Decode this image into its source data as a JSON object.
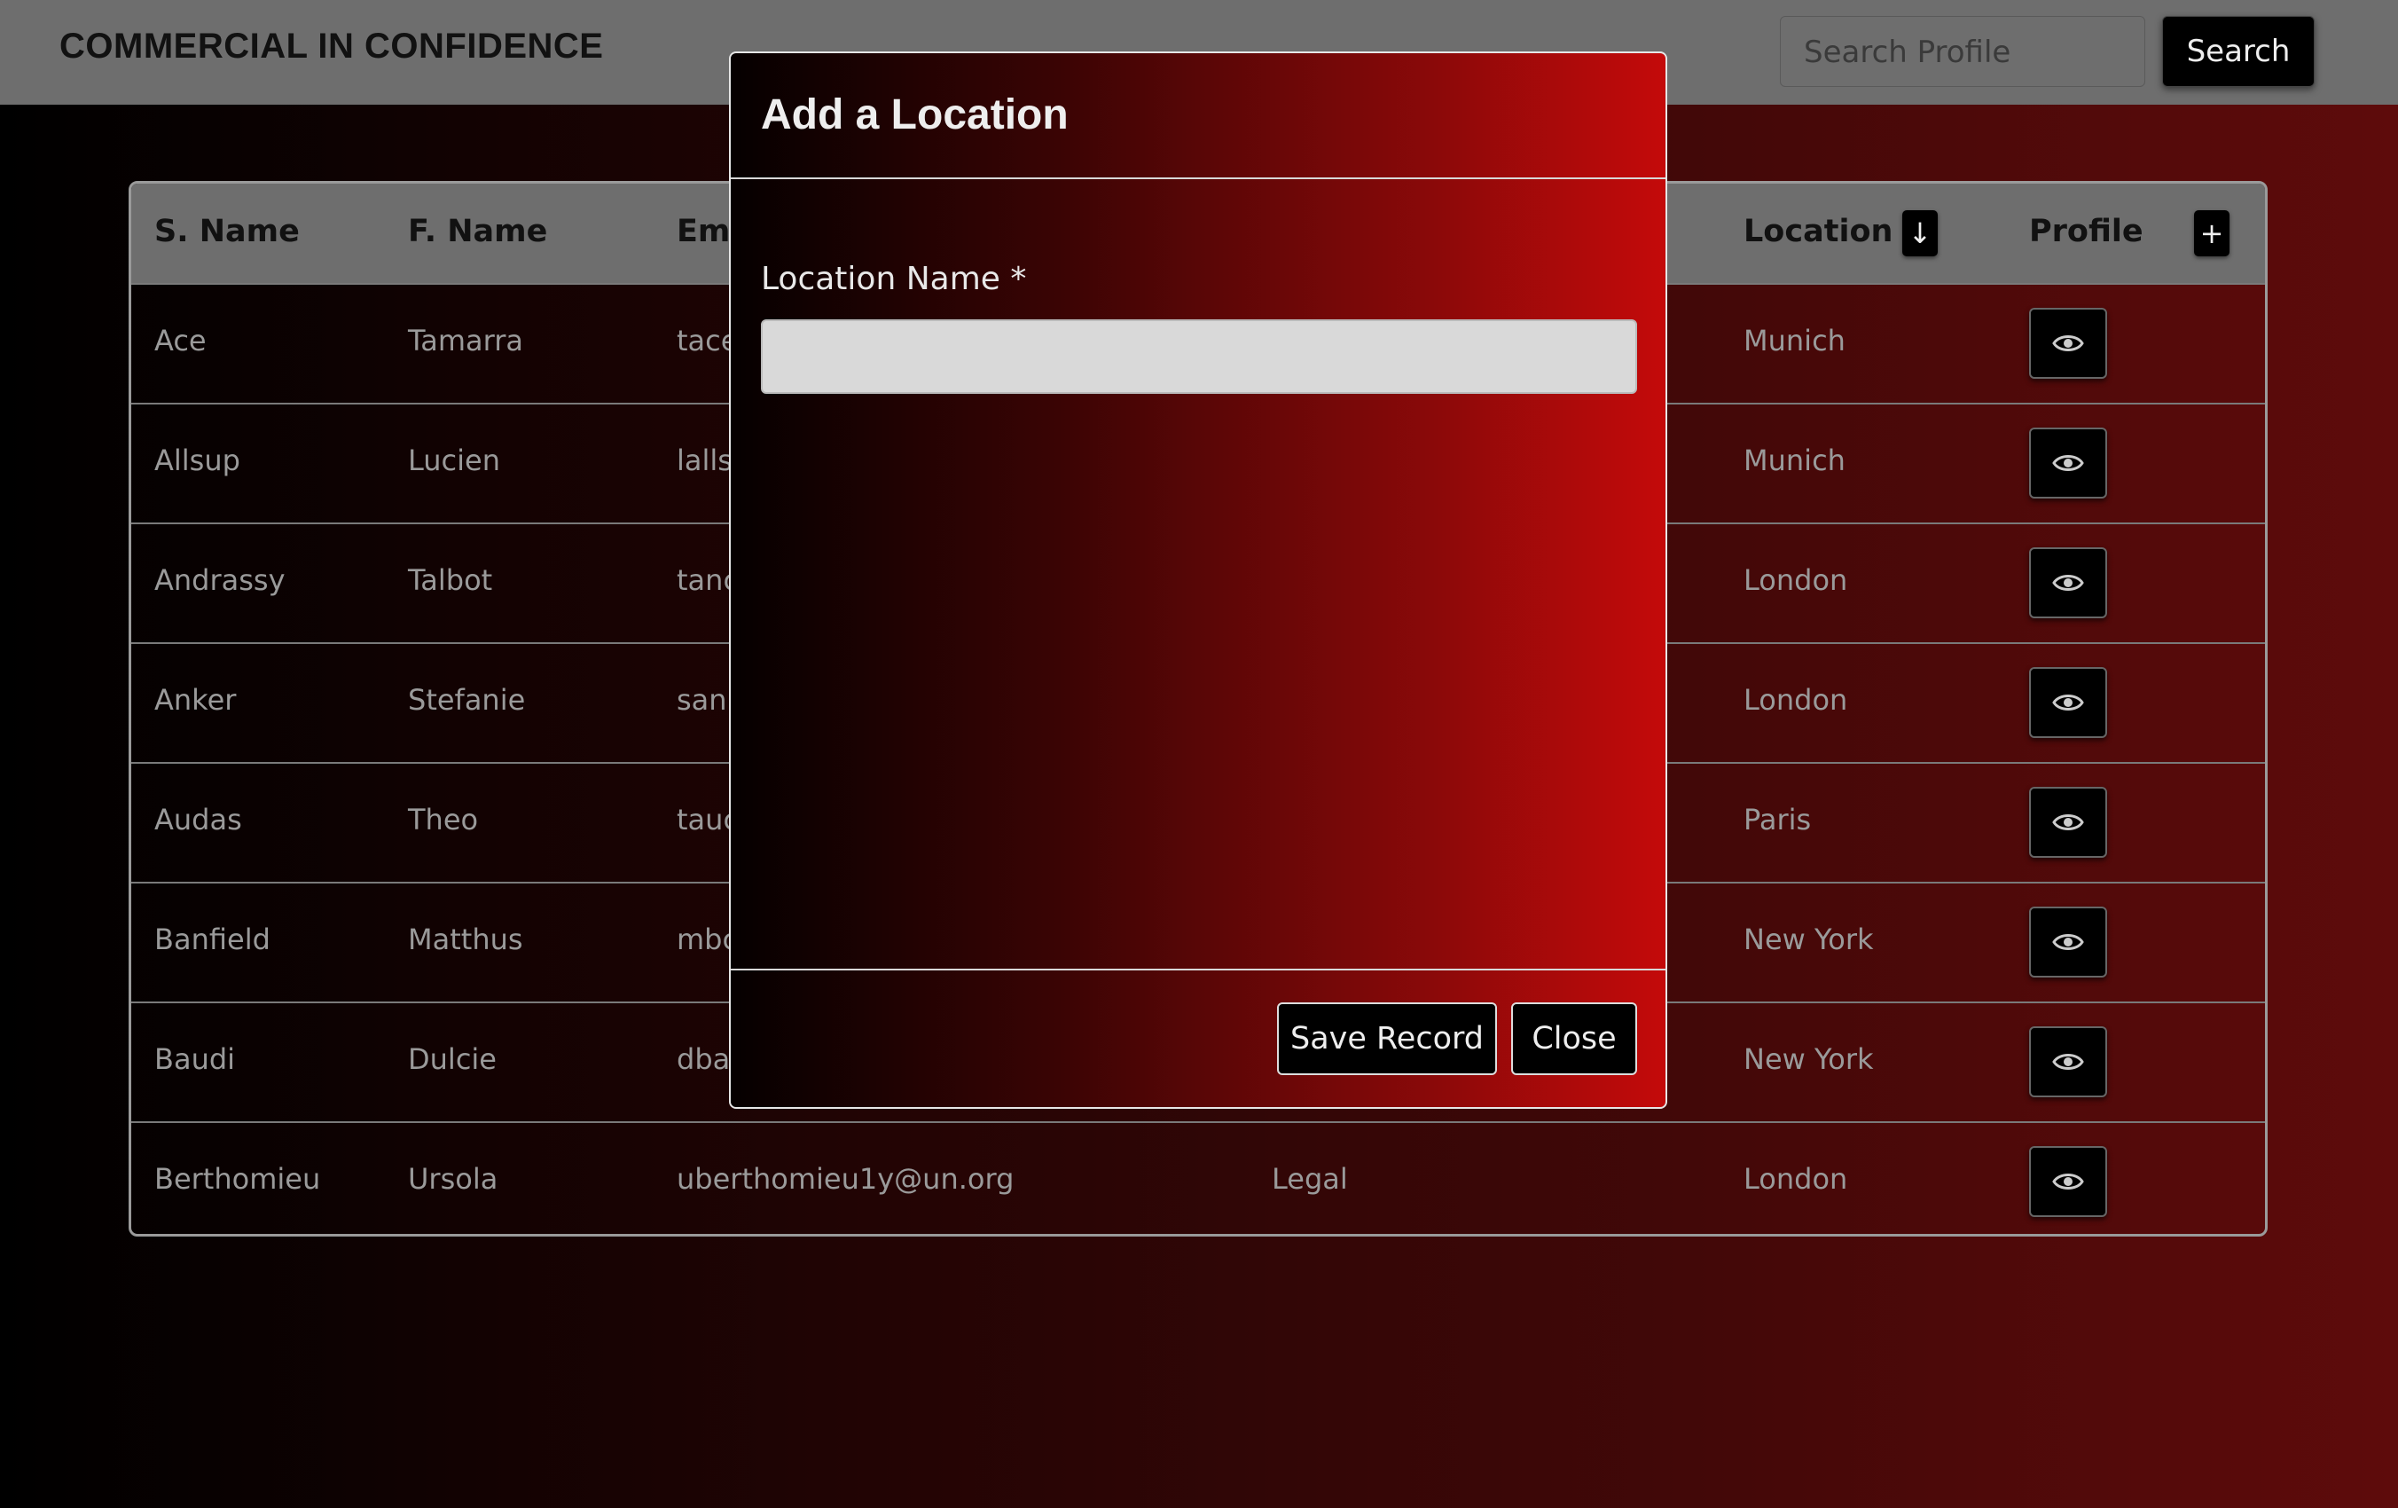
{
  "header": {
    "brand": "COMMERCIAL IN CONFIDENCE",
    "search_placeholder": "Search Profile",
    "search_label": "Search"
  },
  "table": {
    "columns": [
      "S. Name",
      "F. Name",
      "Em",
      "Location",
      "Profile"
    ],
    "sort_icon": "↓",
    "add_icon": "+",
    "rows": [
      {
        "surname": "Ace",
        "forename": "Tamarra",
        "email": "tace",
        "dept": "",
        "location": "Munich"
      },
      {
        "surname": "Allsup",
        "forename": "Lucien",
        "email": "lalls",
        "dept": "",
        "location": "Munich"
      },
      {
        "surname": "Andrassy",
        "forename": "Talbot",
        "email": "tanc",
        "dept": "",
        "location": "London"
      },
      {
        "surname": "Anker",
        "forename": "Stefanie",
        "email": "sanl",
        "dept": "",
        "location": "London"
      },
      {
        "surname": "Audas",
        "forename": "Theo",
        "email": "tauc",
        "dept": "",
        "location": "Paris"
      },
      {
        "surname": "Banfield",
        "forename": "Matthus",
        "email": "mbc",
        "dept": "",
        "location": "New York"
      },
      {
        "surname": "Baudi",
        "forename": "Dulcie",
        "email": "dba",
        "dept": "",
        "location": "New York"
      },
      {
        "surname": "Berthomieu",
        "forename": "Ursola",
        "email": "uberthomieu1y@un.org",
        "dept": "Legal",
        "location": "London"
      }
    ]
  },
  "modal": {
    "title": "Add a Location",
    "field_label": "Location Name *",
    "field_value": "",
    "save_label": "Save Record",
    "close_label": "Close"
  }
}
